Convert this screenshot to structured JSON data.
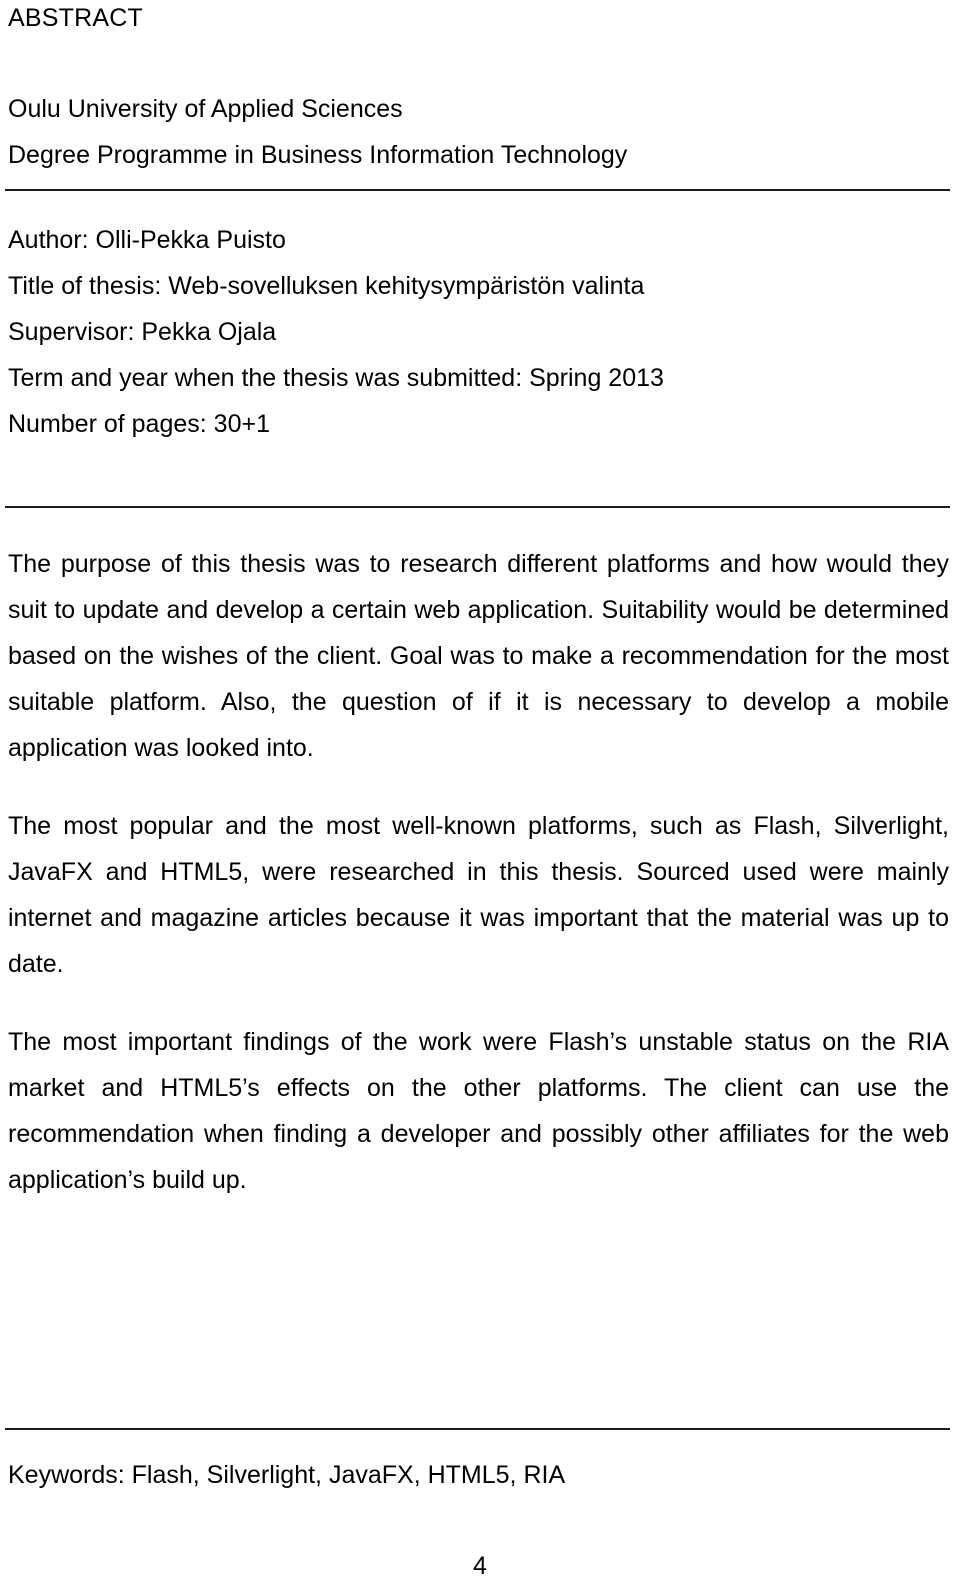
{
  "document": {
    "heading": "ABSTRACT",
    "page_number": "4"
  },
  "institution": {
    "lines": [
      "Oulu University of Applied Sciences",
      "Degree Programme in Business Information  Technology"
    ]
  },
  "metadata": {
    "lines": [
      "Author: Olli-Pekka Puisto",
      "Title of thesis: Web-sovelluksen  kehitysympäristön  valinta",
      "Supervisor: Pekka Ojala",
      "Term and year when the thesis was submitted: Spring 2013",
      "Number of pages: 30+1"
    ],
    "author_label": "Author:",
    "author_value": "Olli-Pekka Puisto",
    "title_label": "Title of thesis:",
    "title_value": "Web-sovelluksen  kehitysympäristön  valinta",
    "supervisor_label": "Supervisor:",
    "supervisor_value": "Pekka Ojala",
    "term_label": "Term and year when the thesis was submitted:",
    "term_value": "Spring 2013",
    "pages_label": "Number of pages:",
    "pages_value": "30+1"
  },
  "abstract": {
    "paragraphs": [
      "The purpose of this thesis was to research different platforms and how would they suit to update and develop a certain web application. Suitability would be determined based on the wishes of the client. Goal was to make a recommendation for the most suitable platform. Also, the question of if it is necessary to develop a mobile application was looked into.",
      "The most popular and the most well-known platforms, such as Flash, Silverlight, JavaFX and HTML5, were researched in this thesis. Sourced used were mainly internet and magazine articles because it was important that the material was up to date.",
      "The most important findings of the work were Flash’s unstable status on the RIA market and HTML5’s effects on the other platforms. The client can use the recommendation when finding a developer and possibly other affiliates for the web application’s build up."
    ]
  },
  "keywords": {
    "text": "Keywords: Flash, Silverlight, JavaFX, HTML5, RIA",
    "label": "Keywords:",
    "items": [
      "Flash",
      "Silverlight",
      "JavaFX",
      "HTML5",
      "RIA"
    ]
  },
  "colors": {
    "text": "#000000",
    "rule": "#1a1a1a",
    "background": "#ffffff"
  }
}
